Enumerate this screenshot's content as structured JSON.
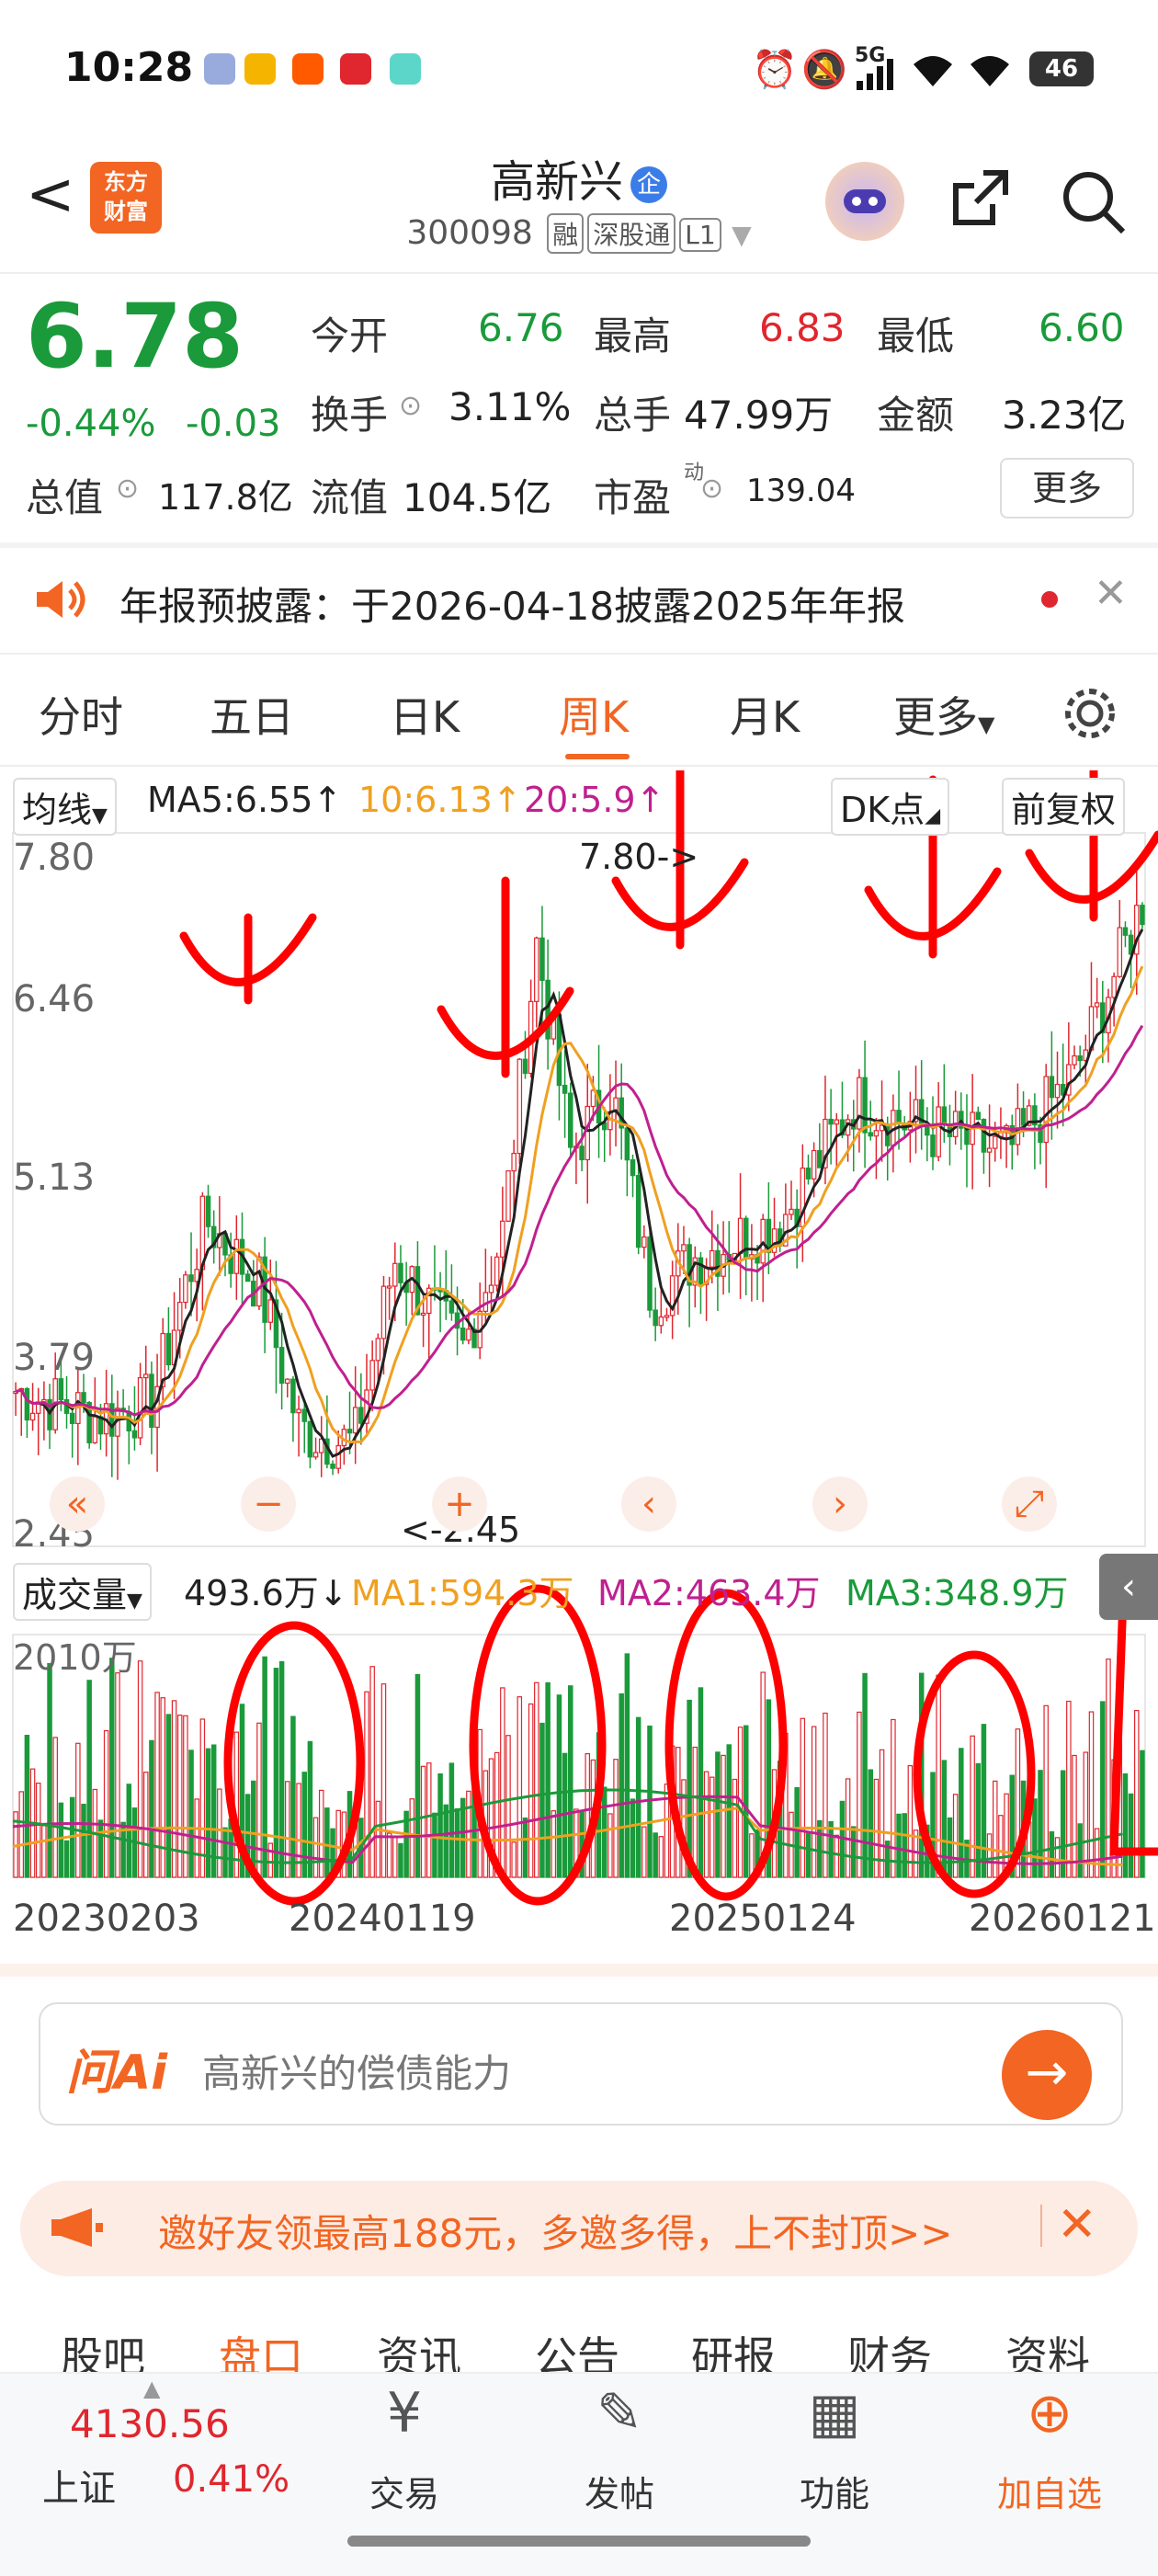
{
  "status_bar": {
    "time": "10:28",
    "signal": "5G",
    "battery": "46"
  },
  "header": {
    "back": "<",
    "logo_line1": "东方",
    "logo_line2": "财富",
    "stock_name": "高新兴",
    "badge": "企",
    "code": "300098",
    "tags": [
      "融",
      "深股通",
      "L1"
    ]
  },
  "quote": {
    "price": "6.78",
    "change_pct": "-0.44%",
    "change": "-0.03",
    "open_label": "今开",
    "open": "6.76",
    "high_label": "最高",
    "high": "6.83",
    "low_label": "最低",
    "low": "6.60",
    "turnover_label": "换手",
    "turnover": "3.11%",
    "volume_label": "总手",
    "volume": "47.99万",
    "amount_label": "金额",
    "amount": "3.23亿",
    "mktcap_label": "总值",
    "mktcap": "117.8亿",
    "float_label": "流值",
    "float": "104.5亿",
    "pe_label": "市盈",
    "pe_sup": "动",
    "pe": "139.04",
    "more": "更多"
  },
  "notice": {
    "text": "年报预披露：于2026-04-18披露2025年年报"
  },
  "tabs": [
    "分时",
    "五日",
    "日K",
    "周K",
    "月K",
    "更多"
  ],
  "active_tab": "周K",
  "chart": {
    "ma_selector": "均线",
    "ma5": "MA5:6.55",
    "ma10": "10:6.13",
    "ma20": "20:5.9",
    "dk_button": "DK点",
    "adjust_button": "前复权",
    "price_axis": [
      "7.80",
      "6.46",
      "5.13",
      "3.79",
      "2.45"
    ],
    "max_marker": "7.80->",
    "min_marker": "<-2.45",
    "vol_selector": "成交量",
    "vol_value": "493.6万",
    "vol_ma1": "MA1:594.3万",
    "vol_ma2": "MA2:463.4万",
    "vol_ma3": "MA3:348.9万",
    "vol_axis_top": "2010万",
    "date_axis": [
      "20230203",
      "20240119",
      "20250124",
      "20260121"
    ],
    "colors": {
      "up": "#e0262e",
      "down": "#1a9a3a",
      "ma5": "#222222",
      "ma10": "#f0a020",
      "ma20": "#c0208f",
      "annotation": "#ff0000"
    }
  },
  "chart_data": {
    "type": "line",
    "title": "",
    "xlabel": "",
    "ylabel": "",
    "x": [
      "20230203",
      "20240119",
      "20250124",
      "20260121"
    ],
    "ylim": [
      2.45,
      7.8
    ],
    "series": [
      {
        "name": "MA5",
        "values": [
          3.6,
          4.8,
          4.6,
          6.55
        ]
      },
      {
        "name": "MA10",
        "values": [
          3.6,
          4.6,
          4.8,
          6.13
        ]
      },
      {
        "name": "MA20",
        "values": [
          3.5,
          4.3,
          5.0,
          5.9
        ]
      }
    ]
  },
  "ai": {
    "logo": "问Ai",
    "placeholder": "高新兴的偿债能力",
    "go": "→"
  },
  "promo": {
    "text": "邀好友领最高188元，多邀多得，上不封顶>>",
    "close": "✕"
  },
  "bottom_tabs": [
    "股吧",
    "盘口",
    "资讯",
    "公告",
    "研报",
    "财务",
    "资料"
  ],
  "bottom_active": "盘口",
  "bottom_bar": {
    "index_value": "4130.56",
    "index_name": "上证",
    "index_change": "0.41%",
    "items": [
      {
        "label": "交易",
        "icon": "¥"
      },
      {
        "label": "发帖",
        "icon": "✎"
      },
      {
        "label": "功能",
        "icon": "▦"
      },
      {
        "label": "加自选",
        "icon": "⊕"
      }
    ]
  }
}
